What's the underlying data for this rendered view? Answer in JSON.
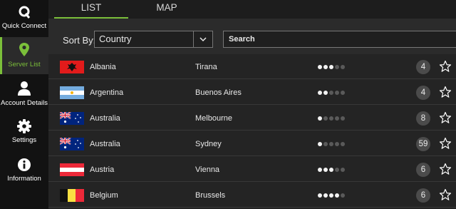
{
  "sidebar": {
    "items": [
      {
        "label": "Quick Connect",
        "icon": "quick-connect-icon"
      },
      {
        "label": "Server List",
        "icon": "location-pin-icon"
      },
      {
        "label": "Account Details",
        "icon": "user-icon"
      },
      {
        "label": "Settings",
        "icon": "gear-icon"
      },
      {
        "label": "Information",
        "icon": "info-icon"
      }
    ],
    "active_index": 1,
    "accent_color": "#7bbf3a"
  },
  "tabs": [
    {
      "label": "LIST",
      "active": true
    },
    {
      "label": "MAP",
      "active": false
    }
  ],
  "controls": {
    "sort_label": "Sort By:",
    "sort_value": "Country",
    "search_placeholder": "Search"
  },
  "servers": [
    {
      "country": "Albania",
      "city": "Tirana",
      "signal": 3,
      "count": "4",
      "flag": "albania"
    },
    {
      "country": "Argentina",
      "city": "Buenos Aires",
      "signal": 2,
      "count": "4",
      "flag": "argentina"
    },
    {
      "country": "Australia",
      "city": "Melbourne",
      "signal": 1,
      "count": "8",
      "flag": "australia"
    },
    {
      "country": "Australia",
      "city": "Sydney",
      "signal": 1,
      "count": "59",
      "flag": "australia"
    },
    {
      "country": "Austria",
      "city": "Vienna",
      "signal": 3,
      "count": "6",
      "flag": "austria"
    },
    {
      "country": "Belgium",
      "city": "Brussels",
      "signal": 4,
      "count": "6",
      "flag": "belgium"
    }
  ]
}
